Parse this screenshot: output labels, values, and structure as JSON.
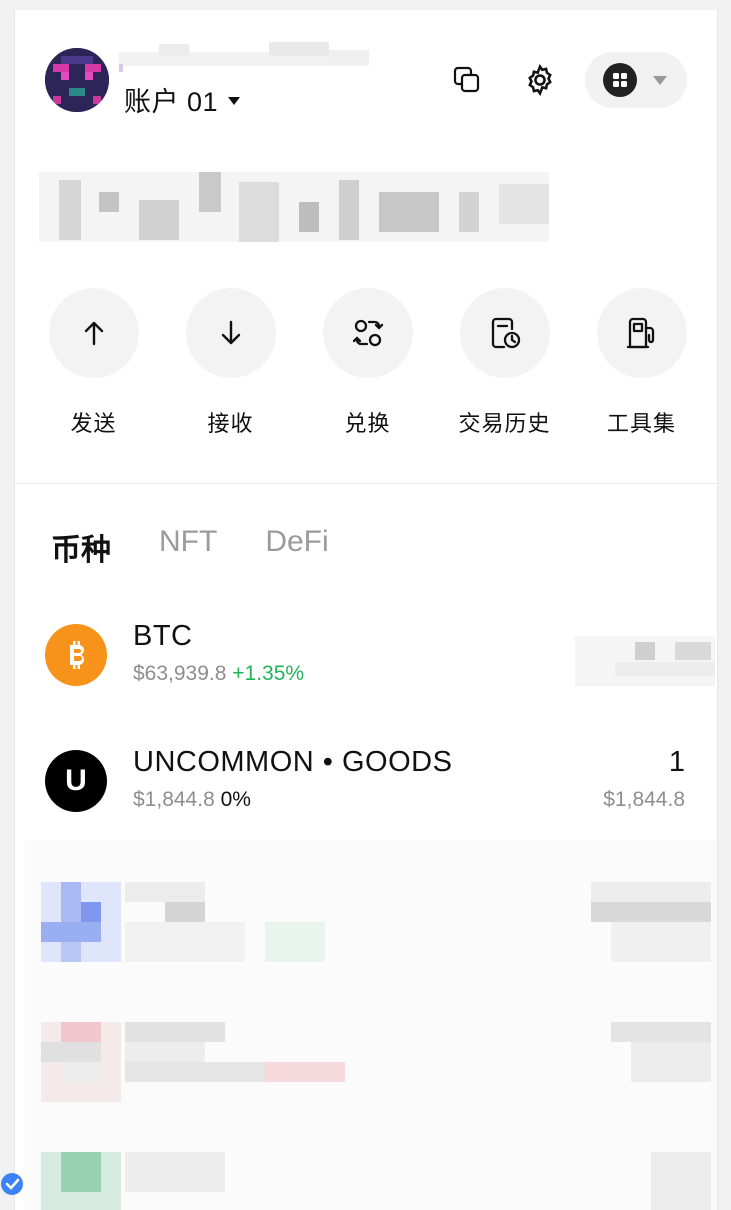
{
  "header": {
    "account_name": "账户 01",
    "icons": {
      "copy": "copy-icon",
      "settings": "gear-icon",
      "apps": "apps-grid-icon",
      "dropdown": "chevron-down-icon"
    }
  },
  "actions": [
    {
      "label": "发送",
      "icon": "arrow-up-icon"
    },
    {
      "label": "接收",
      "icon": "arrow-down-icon"
    },
    {
      "label": "兑换",
      "icon": "swap-icon"
    },
    {
      "label": "交易历史",
      "icon": "history-icon"
    },
    {
      "label": "工具集",
      "icon": "gas-pump-icon"
    }
  ],
  "tabs": [
    {
      "label": "币种",
      "active": true
    },
    {
      "label": "NFT",
      "active": false
    },
    {
      "label": "DeFi",
      "active": false
    }
  ],
  "assets": [
    {
      "symbol": "BTC",
      "price": "$63,939.8",
      "change": "+1.35%",
      "icon_letter": "₿",
      "icon_color": "#f7931a",
      "amount": "",
      "value": ""
    },
    {
      "symbol": "UNCOMMON • GOODS",
      "price": "$1,844.8",
      "change": "0%",
      "icon_letter": "U",
      "icon_color": "#000000",
      "amount": "1",
      "value": "$1,844.8"
    }
  ],
  "colors": {
    "positive": "#20b35a",
    "muted": "#8e8e8e",
    "accent": "#111111"
  }
}
